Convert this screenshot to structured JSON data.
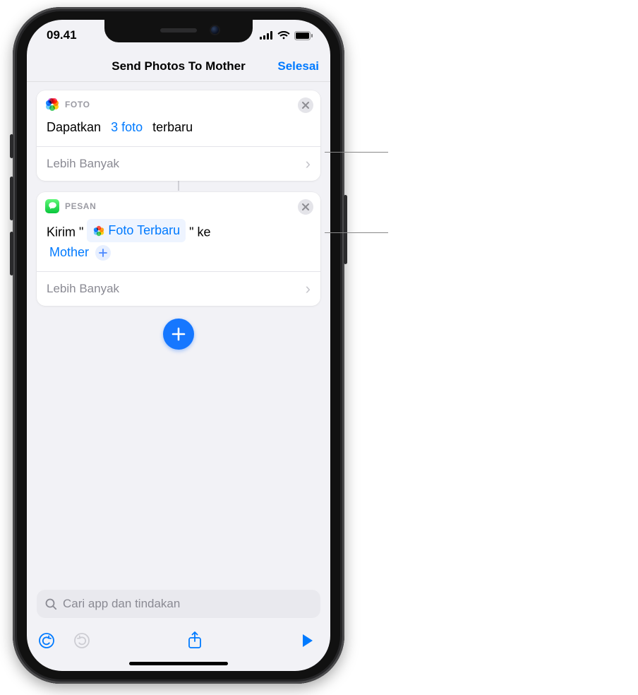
{
  "status": {
    "time": "09.41"
  },
  "nav": {
    "title": "Send Photos To Mother",
    "done": "Selesai"
  },
  "actions": {
    "photo": {
      "app_label": "FOTO",
      "prefix": "Dapatkan",
      "count_token": "3 foto",
      "suffix": "terbaru",
      "expand": "Lebih Banyak"
    },
    "message": {
      "app_label": "PESAN",
      "prefix": "Kirim \"",
      "variable": "Foto Terbaru",
      "mid": "\" ke",
      "recipient": "Mother",
      "expand": "Lebih Banyak"
    }
  },
  "search": {
    "placeholder": "Cari app dan tindakan"
  }
}
